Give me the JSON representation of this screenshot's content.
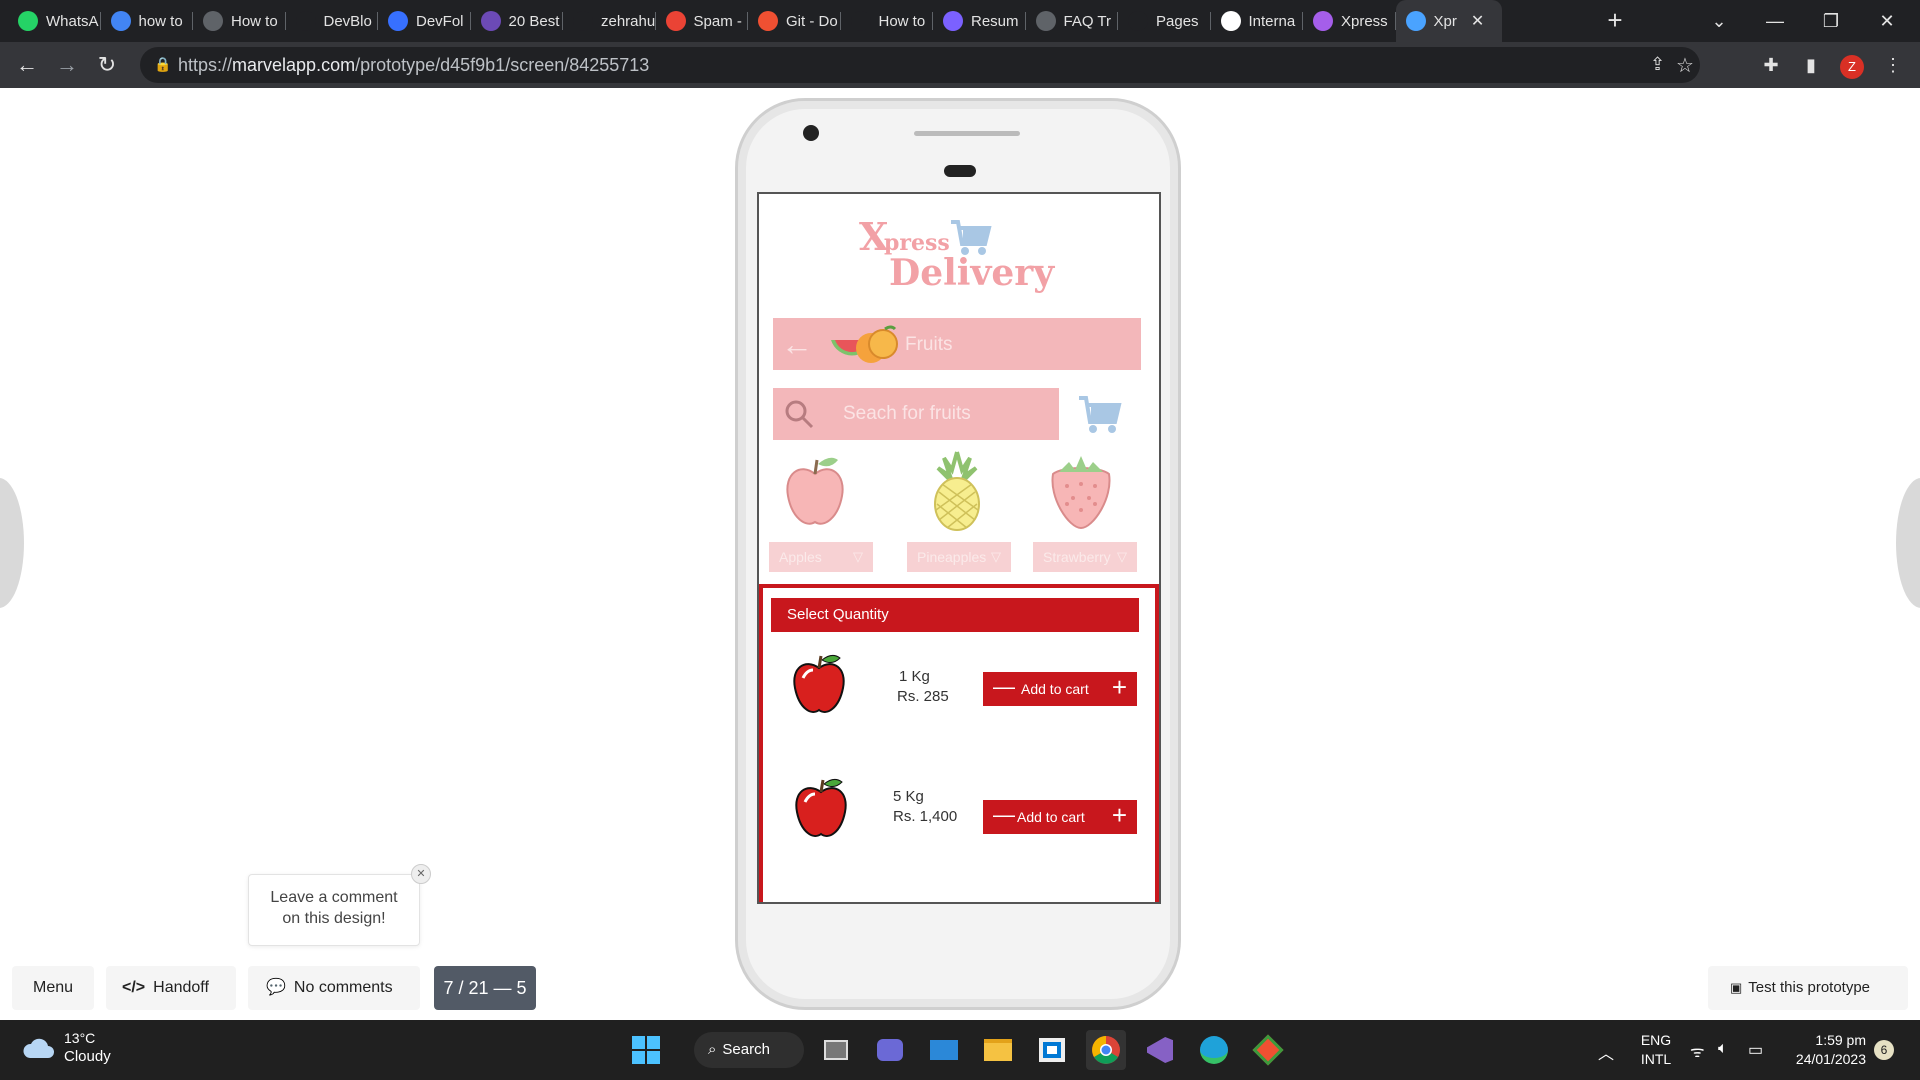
{
  "browser": {
    "tabs": [
      {
        "label": "WhatsA",
        "icon": "whatsapp-icon",
        "color": "#25d366"
      },
      {
        "label": "how to",
        "icon": "google-icon",
        "color": "#4285f4"
      },
      {
        "label": "How to",
        "icon": "openai-icon",
        "color": "#5f6368"
      },
      {
        "label": "DevBlo",
        "icon": "heart-icon",
        "color": "#202124"
      },
      {
        "label": "DevFol",
        "icon": "devfolio-icon",
        "color": "#3770ff"
      },
      {
        "label": "20 Best",
        "icon": "colorlib-icon",
        "color": "#6c4ab6"
      },
      {
        "label": "zehrahu",
        "icon": "github-icon",
        "color": "#202124"
      },
      {
        "label": "Spam -",
        "icon": "gmail-icon",
        "color": "#ea4335"
      },
      {
        "label": "Git - Do",
        "icon": "git-icon",
        "color": "#f05032"
      },
      {
        "label": "How to",
        "icon": "adhoc-icon",
        "color": "#202124"
      },
      {
        "label": "Resum",
        "icon": "resume-icon",
        "color": "#7b61ff"
      },
      {
        "label": "FAQ Tr",
        "icon": "wordpress-icon",
        "color": "#5f6368"
      },
      {
        "label": "Pages",
        "icon": "github-icon",
        "color": "#202124"
      },
      {
        "label": "Interna",
        "icon": "wikipedia-icon",
        "color": "#ffffff"
      },
      {
        "label": "Xpress",
        "icon": "marvel-icon",
        "color": "#a55eea"
      },
      {
        "label": "Xpr",
        "icon": "marvel-icon",
        "color": "#4aa3ff",
        "active": true
      }
    ],
    "url_host": "marvelapp.com",
    "url_path": "/prototype/d45f9b1/screen/84255713",
    "url_scheme": "https://",
    "profile_initial": "Z"
  },
  "app": {
    "logo_x": "X",
    "logo_press": "press",
    "logo_delivery": "Delivery",
    "category_title": "Fruits",
    "search_placeholder": "Seach for fruits",
    "fruits": [
      {
        "label": "Apples"
      },
      {
        "label": "Pineapples"
      },
      {
        "label": "Strawberry"
      }
    ],
    "quantity_header": "Select Quantity",
    "options": [
      {
        "weight": "1 Kg",
        "price": "Rs. 285",
        "button": "Add to cart"
      },
      {
        "weight": "5 Kg",
        "price": "Rs. 1,400",
        "button": "Add to cart"
      }
    ]
  },
  "marvel": {
    "comment_bubble_line1": "Leave a comment",
    "comment_bubble_line2": "on this design!",
    "menu_label": "Menu",
    "handoff_label": "Handoff",
    "comments_label": "No comments",
    "page_counter": "7 / 21 — 5",
    "test_label": "Test this prototype"
  },
  "taskbar": {
    "temperature": "13°C",
    "weather": "Cloudy",
    "search_label": "Search",
    "lang_top": "ENG",
    "lang_bottom": "INTL",
    "time": "1:59 pm",
    "date": "24/01/2023",
    "notification_count": "6"
  },
  "colors": {
    "accent_red": "#c8171d",
    "faded_pink": "#f3b7ba",
    "logo_pink": "#f2a1a6",
    "browser_dark": "#202124"
  }
}
